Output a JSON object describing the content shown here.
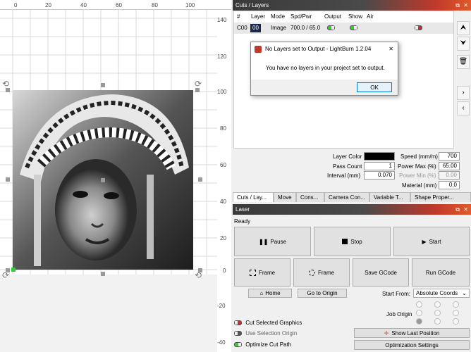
{
  "workspace": {
    "ruler_top": [
      "0",
      "20",
      "40",
      "60",
      "80",
      "100"
    ],
    "ruler_right": [
      "140",
      "120",
      "100",
      "80",
      "60",
      "40",
      "20",
      "0",
      "-20",
      "-40"
    ]
  },
  "cuts_layers": {
    "title": "Cuts / Layers",
    "columns": [
      "#",
      "Layer",
      "Mode",
      "Spd/Pwr",
      "Output",
      "Show",
      "Air"
    ],
    "row": {
      "num": "C00",
      "layer": "00",
      "mode": "Image",
      "spdpwr": "700.0 / 65.0"
    },
    "layer_color_label": "Layer Color",
    "pass_count_label": "Pass Count",
    "pass_count_value": "1",
    "interval_label": "Interval (mm)",
    "interval_value": "0.070",
    "speed_label": "Speed (mm/m)",
    "speed_value": "700",
    "power_max_label": "Power Max (%)",
    "power_max_value": "65.00",
    "power_min_label": "Power Min (%)",
    "power_min_value": "0.00",
    "material_label": "Material (mm)",
    "material_value": "0.0"
  },
  "tabs": [
    "Cuts / Lay...",
    "Move",
    "Cons...",
    "Camera Con...",
    "Variable T...",
    "Shape Proper..."
  ],
  "laser": {
    "title": "Laser",
    "status": "Ready",
    "pause": "Pause",
    "stop": "Stop",
    "start": "Start",
    "frame1": "Frame",
    "frame2": "Frame",
    "save_gcode": "Save GCode",
    "run_gcode": "Run GCode",
    "home": "Home",
    "go_to_origin": "Go to Origin",
    "start_from_label": "Start From:",
    "start_from_value": "Absolute Coords",
    "job_origin_label": "Job Origin",
    "cut_selected": "Cut Selected Graphics",
    "use_selection_origin": "Use Selection Origin",
    "optimize_cut_path": "Optimize Cut Path",
    "show_last_position": "Show Last Position",
    "optimization_settings": "Optimization Settings"
  },
  "dialog": {
    "title": "No Layers set to Output - LightBurn 1.2.04",
    "message": "You have no layers in your project set to output.",
    "ok": "OK",
    "close": "✕"
  },
  "colors": {
    "accent": "#c0392b",
    "toggle_on": "#33cc33",
    "toggle_off": "#bb3333"
  }
}
